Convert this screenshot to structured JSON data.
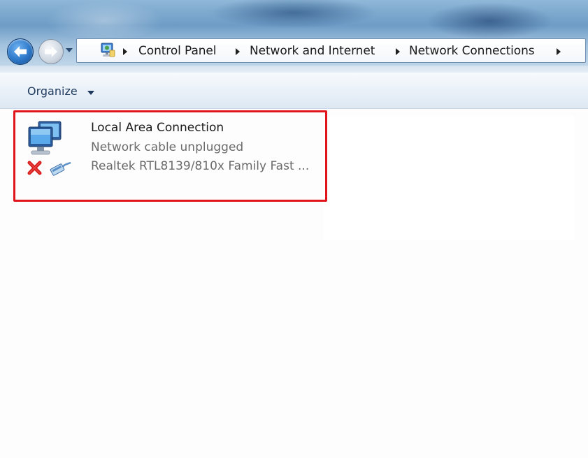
{
  "address_bar": {
    "breadcrumbs": [
      "Control Panel",
      "Network and Internet",
      "Network Connections"
    ]
  },
  "toolbar": {
    "organize_label": "Organize"
  },
  "connections": [
    {
      "name": "Local Area Connection",
      "status": "Network cable unplugged",
      "device": "Realtek RTL8139/810x Family Fast ...",
      "icon": "network-adapter-icon",
      "status_icon": "disconnected-x-icon",
      "highlight_color": "#e0141a"
    }
  ],
  "colors": {
    "title_bar": "#6d9cc6",
    "command_bar": "#e9f0f8",
    "link_text": "#1e395b",
    "secondary_text": "#6b6b6b"
  }
}
